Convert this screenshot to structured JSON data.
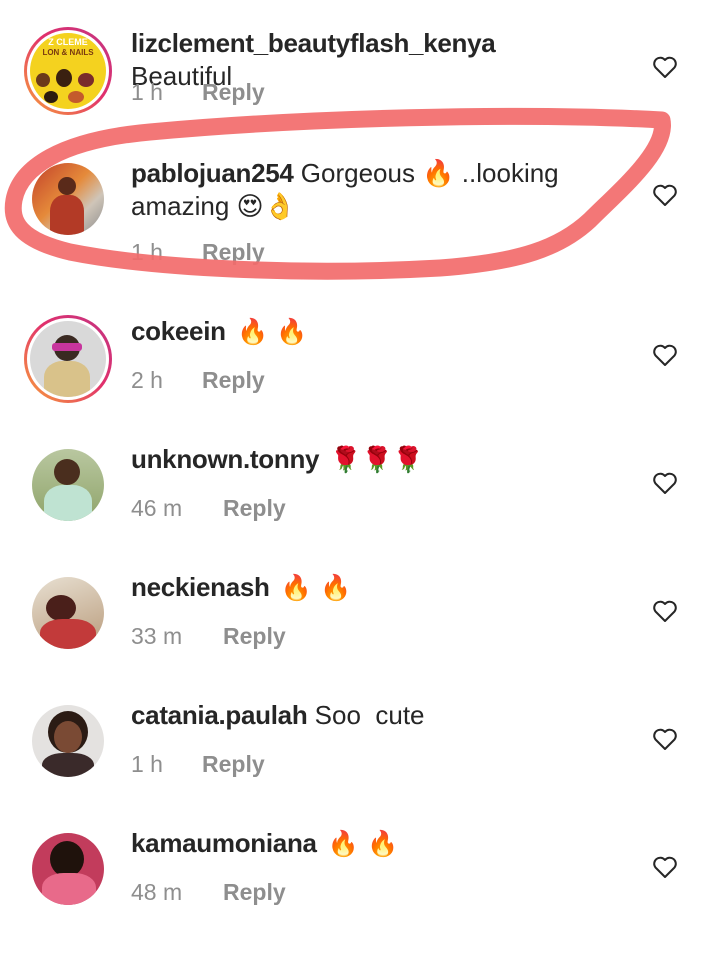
{
  "comments": [
    {
      "username": "lizclement_beautyflash_kenya",
      "text": "Beautiful",
      "time": "1 h",
      "reply": "Reply",
      "avatar_text": [
        "Z CLEME",
        "LON & NAILS"
      ]
    },
    {
      "username": "pablojuan254",
      "text": "Gorgeous 🔥 ..looking amazing 😍👌",
      "time": "1 h",
      "reply": "Reply"
    },
    {
      "username": "cokeein",
      "text": "🔥 🔥",
      "time": "2 h",
      "reply": "Reply"
    },
    {
      "username": "unknown.tonny",
      "text": "🌹🌹🌹",
      "time": "46 m",
      "reply": "Reply"
    },
    {
      "username": "neckienash",
      "text": "🔥 🔥",
      "time": "33 m",
      "reply": "Reply"
    },
    {
      "username": "catania.paulah",
      "text": "Soo  cute",
      "time": "1 h",
      "reply": "Reply"
    },
    {
      "username": "kamaumoniana",
      "text": "🔥 🔥",
      "time": "48 m",
      "reply": "Reply"
    }
  ],
  "colors": {
    "annotation_stroke": "#f26b6b",
    "story_ring_start": "#f9a33a",
    "story_ring_end": "#c13584"
  },
  "icons": {
    "like": "heart-outline-icon"
  }
}
